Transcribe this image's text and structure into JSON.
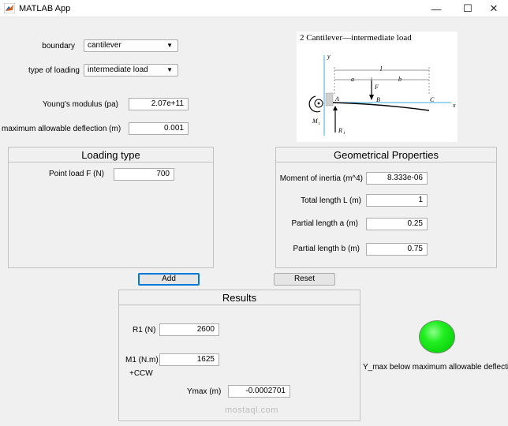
{
  "window": {
    "title": "MATLAB App",
    "minimize_glyph": "—",
    "maximize_glyph": "☐",
    "close_glyph": "✕"
  },
  "inputs": {
    "boundary_label": "boundary",
    "boundary_value": "cantilever",
    "loading_label": "type of loading",
    "loading_value": "intermediate load",
    "youngs_label": "Young's modulus (pa)",
    "youngs_value": "2.07e+11",
    "deflection_label": "maximum allowable deflection (m)",
    "deflection_value": "0.001"
  },
  "diagram": {
    "heading": "2  Cantilever—intermediate load",
    "y": "y",
    "x": "x",
    "l": "l",
    "a": "a",
    "b": "b",
    "F": "F",
    "A": "A",
    "B": "B",
    "C": "C",
    "M1": "M",
    "M1_sub": "1",
    "R1": "R",
    "R1_sub": "1"
  },
  "loading_panel": {
    "title": "Loading type",
    "point_load_label": "Point load F (N)",
    "point_load_value": "700"
  },
  "geometry_panel": {
    "title": "Geometrical Properties",
    "inertia_label": "Moment of inertia (m^4)",
    "inertia_value": "8.333e-06",
    "total_length_label": "Total length L (m)",
    "total_length_value": "1",
    "partial_a_label": "Partial length  a (m)",
    "partial_a_value": "0.25",
    "partial_b_label": "Partial length b (m)",
    "partial_b_value": "0.75"
  },
  "buttons": {
    "add": "Add",
    "reset": "Reset"
  },
  "results": {
    "title": "Results",
    "r1_label": "R1 (N)",
    "r1_value": "2600",
    "m1_label": "M1 (N.m)",
    "m1_value": "1625",
    "ccw_label": "+CCW",
    "ymax_label": "Ymax (m)",
    "ymax_value": "-0.0002701"
  },
  "status": {
    "lamp_color": "#00e000",
    "message": "Y_max below maximum allowable deflection"
  },
  "watermark": {
    "text": "mostaql.com"
  }
}
